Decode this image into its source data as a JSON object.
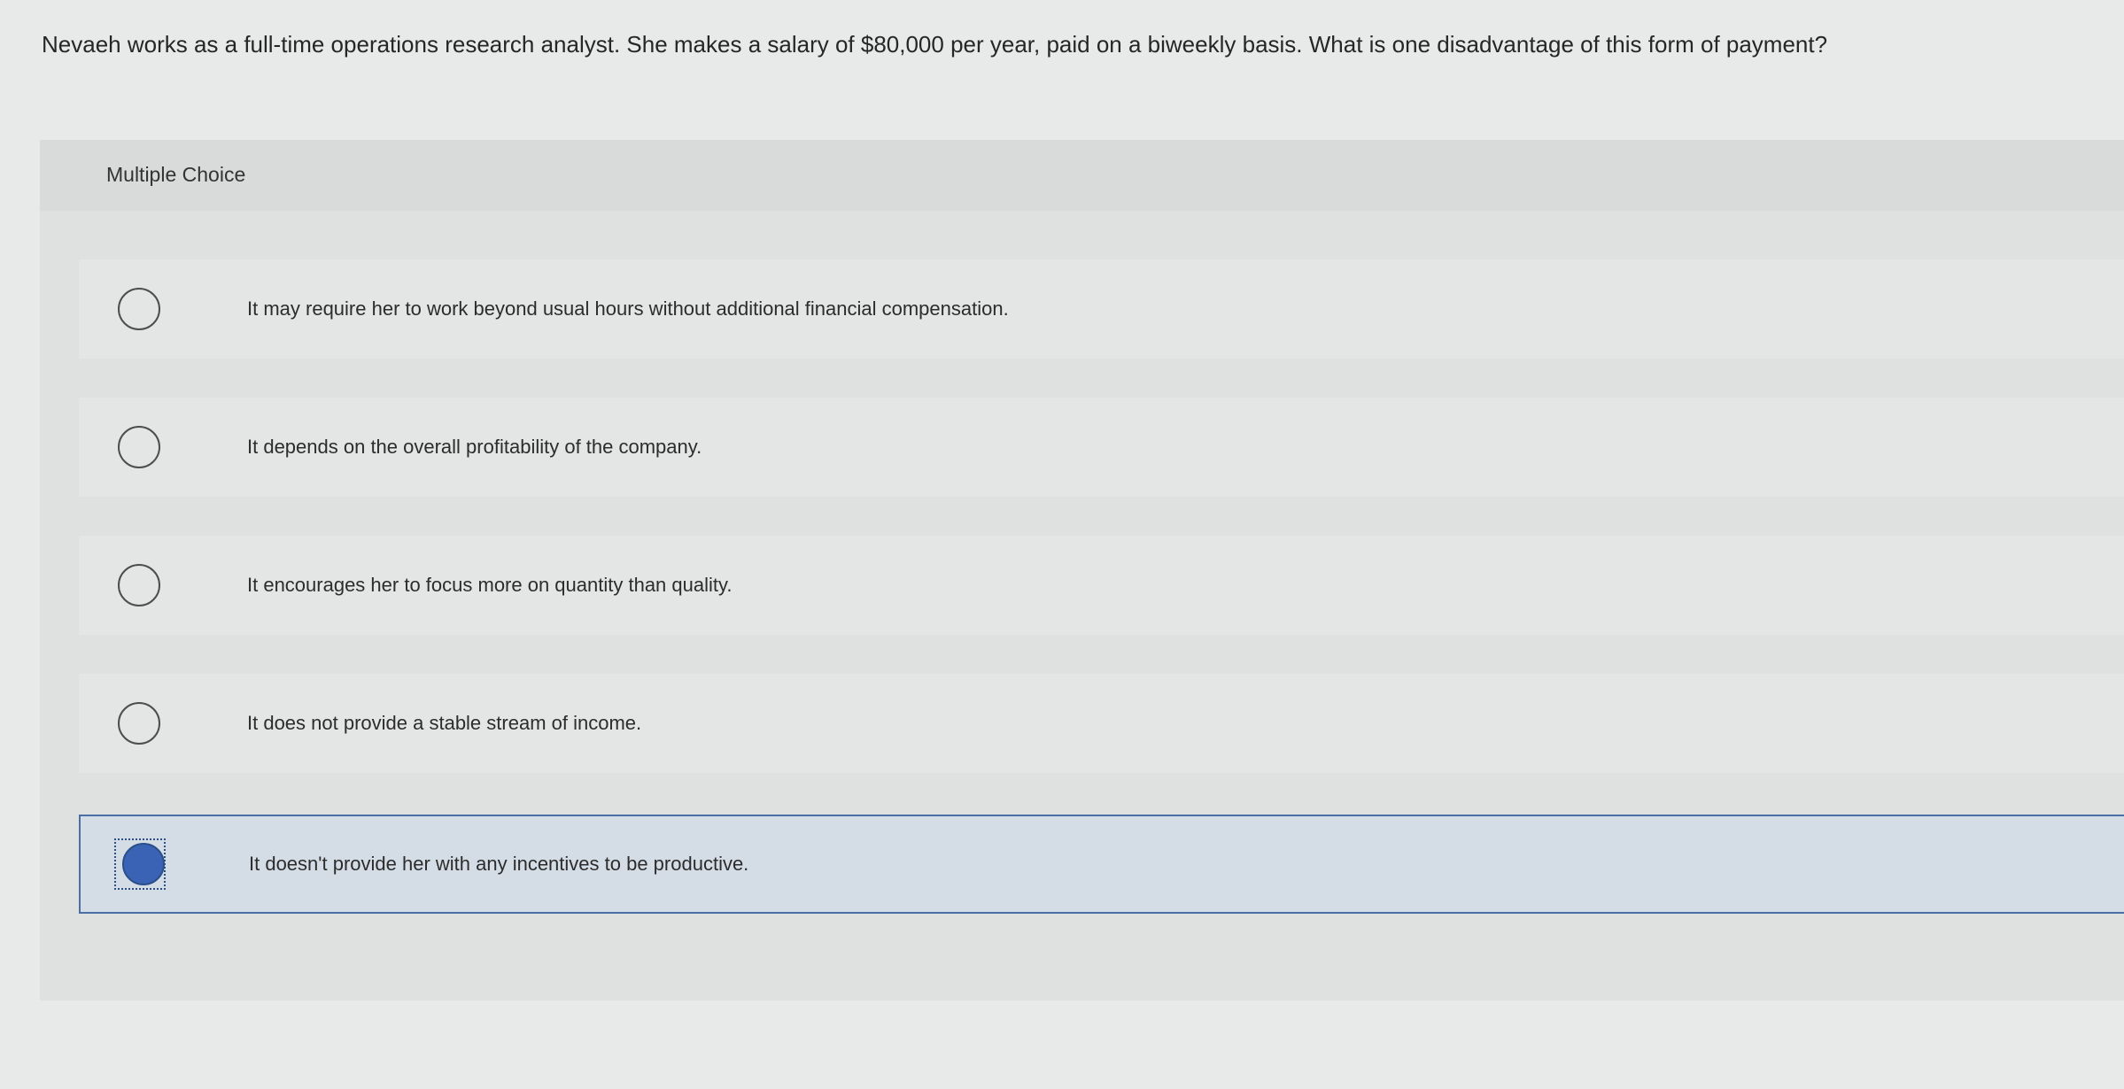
{
  "question": {
    "text": "Nevaeh works as a full-time operations research analyst. She makes a salary of $80,000 per year, paid on a biweekly basis. What is one disadvantage of this form of payment?"
  },
  "panel": {
    "title": "Multiple Choice"
  },
  "choices": [
    {
      "label": "It may require her to work beyond usual hours without additional financial compensation.",
      "selected": false
    },
    {
      "label": "It depends on the overall profitability of the company.",
      "selected": false
    },
    {
      "label": "It encourages her to focus more on quantity than quality.",
      "selected": false
    },
    {
      "label": "It does not provide a stable stream of income.",
      "selected": false
    },
    {
      "label": "It doesn't provide her with any incentives to be productive.",
      "selected": true
    }
  ],
  "colors": {
    "selected_fill": "#3a63b5",
    "selected_border": "#4a6fa5",
    "selected_background": "#d4dde6"
  }
}
